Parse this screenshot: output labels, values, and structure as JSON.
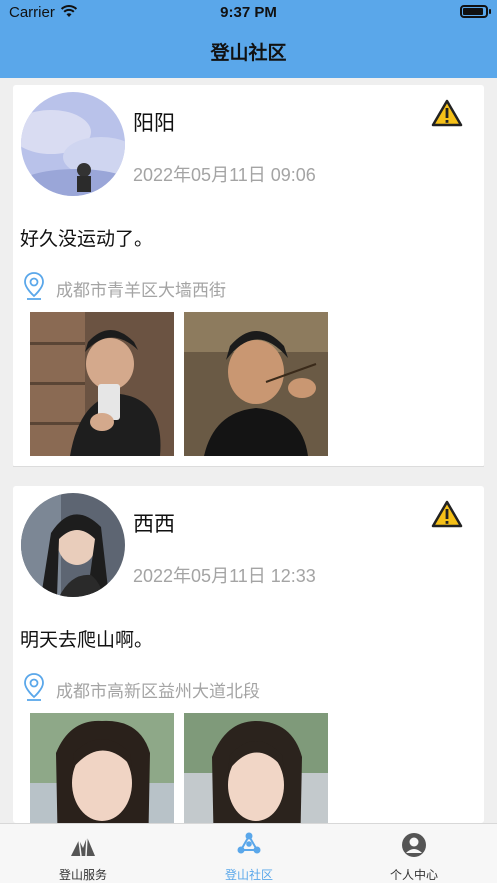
{
  "status_bar": {
    "carrier": "Carrier",
    "time": "9:37 PM"
  },
  "header": {
    "title": "登山社区"
  },
  "posts": [
    {
      "username": "阳阳",
      "time": "2022年05月11日 09:06",
      "content": "好久没运动了。",
      "location": "成都市青羊区大墙西街"
    },
    {
      "username": "西西",
      "time": "2022年05月11日 12:33",
      "content": "明天去爬山啊。",
      "location": "成都市高新区益州大道北段"
    }
  ],
  "tabs": [
    {
      "label": "登山服务",
      "icon": "mountain-icon"
    },
    {
      "label": "登山社区",
      "icon": "community-icon"
    },
    {
      "label": "个人中心",
      "icon": "person-icon"
    }
  ],
  "colors": {
    "primary": "#5aa7ea",
    "secondary_text": "#a4a4a4",
    "background": "#efefef"
  },
  "active_tab": "登山社区"
}
